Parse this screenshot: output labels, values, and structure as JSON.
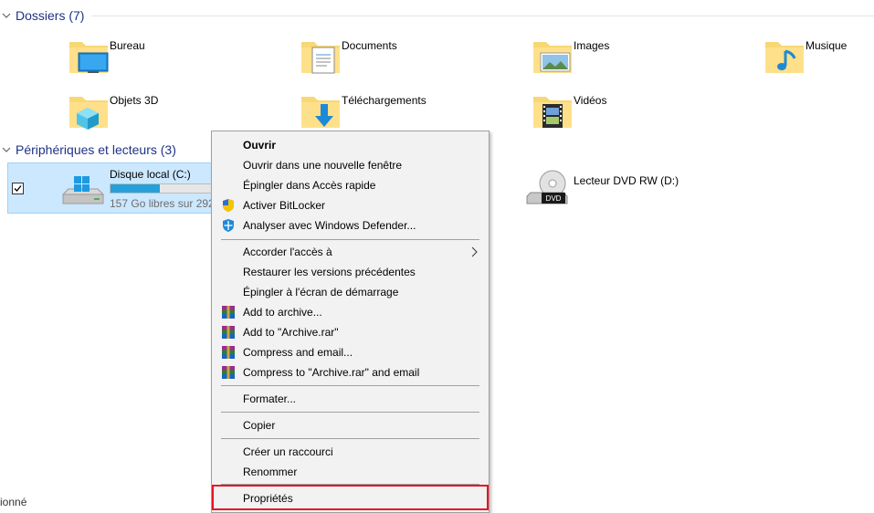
{
  "sections": {
    "folders_header": "Dossiers (7)",
    "devices_header": "Périphériques et lecteurs (3)"
  },
  "folders": [
    {
      "label": "Bureau",
      "icon": "desktop-folder-icon"
    },
    {
      "label": "Documents",
      "icon": "documents-folder-icon"
    },
    {
      "label": "Images",
      "icon": "pictures-folder-icon"
    },
    {
      "label": "Musique",
      "icon": "music-folder-icon"
    },
    {
      "label": "Objets 3D",
      "icon": "3d-objects-folder-icon"
    },
    {
      "label": "Téléchargements",
      "icon": "downloads-folder-icon"
    },
    {
      "label": "Vidéos",
      "icon": "videos-folder-icon"
    }
  ],
  "drives": {
    "local": {
      "name": "Disque local (C:)",
      "free_text": "157 Go libres sur 292",
      "used_fraction": 0.46
    },
    "dvd": {
      "name": "Lecteur DVD RW (D:)",
      "disc_label": "DVD"
    }
  },
  "status_bar": {
    "text": "ionné"
  },
  "context_menu": {
    "items": [
      {
        "label": "Ouvrir",
        "bold": true
      },
      {
        "label": "Ouvrir dans une nouvelle fenêtre"
      },
      {
        "label": "Épingler dans Accès rapide"
      },
      {
        "label": "Activer BitLocker",
        "icon": "shield-icon"
      },
      {
        "label": "Analyser avec Windows Defender...",
        "icon": "defender-icon"
      },
      {
        "label": "Accorder l'accès à",
        "submenu": true
      },
      {
        "label": "Restaurer les versions précédentes"
      },
      {
        "label": "Épingler à l'écran de démarrage"
      },
      {
        "label": "Add to archive...",
        "icon": "winrar-icon"
      },
      {
        "label": "Add to \"Archive.rar\"",
        "icon": "winrar-icon"
      },
      {
        "label": "Compress and email...",
        "icon": "winrar-icon"
      },
      {
        "label": "Compress to \"Archive.rar\" and email",
        "icon": "winrar-icon"
      },
      {
        "label": "Formater..."
      },
      {
        "label": "Copier"
      },
      {
        "label": "Créer un raccourci"
      },
      {
        "label": "Renommer"
      },
      {
        "label": "Propriétés",
        "highlighted": true
      }
    ]
  },
  "colors": {
    "section_title": "#1e3287",
    "selection_bg": "#cce8ff",
    "selection_border": "#99d1ff",
    "drive_bar_fill": "#26a0da",
    "menu_bg": "#f2f2f2",
    "highlight_border": "#e81123"
  }
}
